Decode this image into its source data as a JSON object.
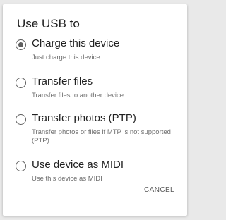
{
  "dialog": {
    "title": "Use USB to",
    "options": [
      {
        "label": "Charge this device",
        "description": "Just charge this device",
        "selected": true
      },
      {
        "label": "Transfer files",
        "description": "Transfer files to another device",
        "selected": false
      },
      {
        "label": "Transfer photos (PTP)",
        "description": "Transfer photos or files if MTP is not supported (PTP)",
        "selected": false
      },
      {
        "label": "Use device as MIDI",
        "description": "Use this device as MIDI",
        "selected": false
      }
    ],
    "cancel_label": "CANCEL"
  }
}
